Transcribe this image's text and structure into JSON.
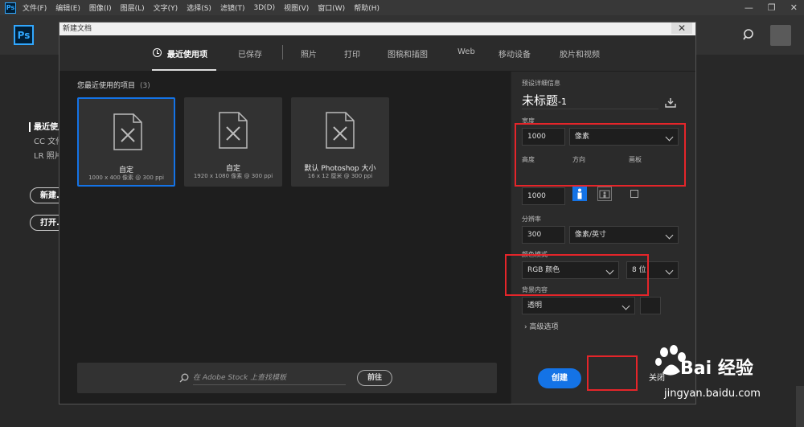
{
  "menubar": {
    "logo": "Ps",
    "items": [
      "文件(F)",
      "编辑(E)",
      "图像(I)",
      "图层(L)",
      "文字(Y)",
      "选择(S)",
      "滤镜(T)",
      "3D(D)",
      "视图(V)",
      "窗口(W)",
      "帮助(H)"
    ],
    "controls": [
      "—",
      "❐",
      "✕"
    ]
  },
  "home": {
    "logo": "Ps",
    "nav": [
      "最近使用项",
      "CC 文件",
      "LR 照片"
    ],
    "new_button": "新建...",
    "open_button": "打开..."
  },
  "dialog": {
    "title": "新建文档",
    "close": "✕",
    "tabs": [
      "最近使用项",
      "已保存",
      "照片",
      "打印",
      "图稿和插图",
      "Web",
      "移动设备",
      "胶片和视频"
    ],
    "recent_header": "您最近使用的项目",
    "recent_count": "(3)",
    "presets": [
      {
        "name": "自定",
        "size": "1000 x 400 像素 @ 300 ppi"
      },
      {
        "name": "自定",
        "size": "1920 x 1080 像素 @ 300 ppi"
      },
      {
        "name": "默认 Photoshop 大小",
        "size": "16 x 12 厘米 @ 300 ppi"
      }
    ],
    "stock_placeholder": "在 Adobe Stock 上查找模板",
    "go_button": "前往",
    "details": {
      "header": "预设详细信息",
      "doc_title": "未标题",
      "doc_title_suffix": "-1",
      "width_label": "宽度",
      "width_value": "1000",
      "unit": "像素",
      "height_label": "高度",
      "height_value": "1000",
      "orientation_label": "方向",
      "artboard_label": "画板",
      "resolution_label": "分辨率",
      "resolution_value": "300",
      "resolution_unit": "像素/英寸",
      "color_mode_label": "颜色模式",
      "color_mode": "RGB 颜色",
      "bit_depth": "8 位",
      "background_label": "背景内容",
      "background_value": "透明",
      "advanced": "高级选项"
    },
    "create_button": "创建",
    "close_button": "关闭"
  },
  "watermark": {
    "brand": "Bai 经验",
    "url": "jingyan.baidu.com"
  },
  "colors": {
    "accent": "#1473e6",
    "highlight": "#e5252a",
    "ps_blue": "#31a8ff"
  }
}
